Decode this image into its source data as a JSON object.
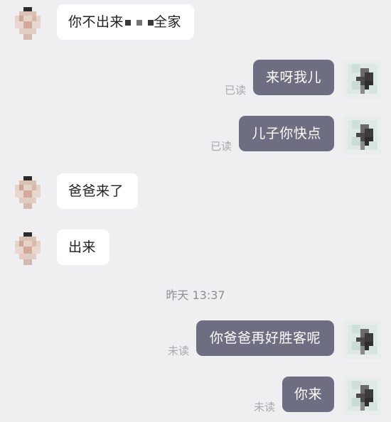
{
  "messages": [
    {
      "direction": "in",
      "text_a": "你不出来",
      "text_b": "全家",
      "censored": true,
      "avatar": "pixelated-avatar-left"
    },
    {
      "direction": "out",
      "text": "来呀我儿",
      "status": "已读",
      "avatar": "pixelated-avatar-right"
    },
    {
      "direction": "out",
      "text": "儿子你快点",
      "status": "已读",
      "avatar": "pixelated-avatar-right"
    },
    {
      "direction": "in",
      "text": "爸爸来了",
      "avatar": "pixelated-avatar-left"
    },
    {
      "direction": "in",
      "text": "出来",
      "avatar": "pixelated-avatar-left"
    },
    {
      "direction": "out",
      "text": "你爸爸再好胜客呢",
      "status": "未读",
      "avatar": "pixelated-avatar-right"
    },
    {
      "direction": "out",
      "text": "你来",
      "status": "未读",
      "avatar": "pixelated-avatar-right"
    }
  ],
  "timestamp": "昨天 13:37",
  "colors": {
    "background": "#efeff2",
    "incoming_bubble": "#ffffff",
    "outgoing_bubble": "#6e6e82",
    "status_text": "#a9a9ae"
  }
}
